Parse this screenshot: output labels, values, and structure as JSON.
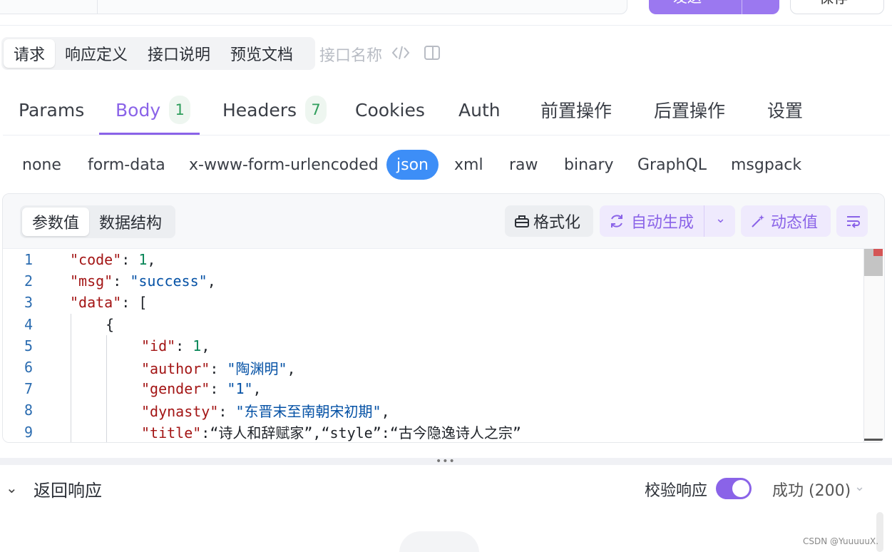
{
  "send": {
    "label": "发送"
  },
  "save": {
    "label": "保存"
  },
  "request_subtabs": [
    {
      "label": "请求",
      "active": true
    },
    {
      "label": "响应定义"
    },
    {
      "label": "接口说明"
    },
    {
      "label": "预览文档"
    }
  ],
  "api_name_placeholder": "接口名称",
  "main_tabs": [
    {
      "label": "Params"
    },
    {
      "label": "Body",
      "badge": "1",
      "active": true
    },
    {
      "label": "Headers",
      "badge": "7"
    },
    {
      "label": "Cookies"
    },
    {
      "label": "Auth"
    },
    {
      "label": "前置操作"
    },
    {
      "label": "后置操作"
    },
    {
      "label": "设置"
    }
  ],
  "body_types": [
    "none",
    "form-data",
    "x-www-form-urlencoded",
    "json",
    "xml",
    "raw",
    "binary",
    "GraphQL",
    "msgpack"
  ],
  "body_type_selected": "json",
  "editor": {
    "view_tabs": [
      {
        "label": "参数值",
        "active": true
      },
      {
        "label": "数据结构"
      }
    ],
    "format_label": "格式化",
    "auto_generate_label": "自动生成",
    "dynamic_value_label": "动态值",
    "line_numbers": [
      "1",
      "2",
      "3",
      "4",
      "5",
      "6",
      "7",
      "8",
      "9"
    ],
    "lines": [
      {
        "indent": 0,
        "tokens": [
          [
            "k",
            "\"code\""
          ],
          [
            "p",
            ": "
          ],
          [
            "n",
            "1"
          ],
          [
            "p",
            ","
          ]
        ]
      },
      {
        "indent": 0,
        "tokens": [
          [
            "k",
            "\"msg\""
          ],
          [
            "p",
            ": "
          ],
          [
            "s",
            "\"success\""
          ],
          [
            "p",
            ","
          ]
        ]
      },
      {
        "indent": 0,
        "tokens": [
          [
            "k",
            "\"data\""
          ],
          [
            "p",
            ": ["
          ]
        ]
      },
      {
        "indent": 1,
        "tokens": [
          [
            "p",
            "{"
          ]
        ]
      },
      {
        "indent": 2,
        "tokens": [
          [
            "k",
            "\"id\""
          ],
          [
            "p",
            ": "
          ],
          [
            "n",
            "1"
          ],
          [
            "p",
            ","
          ]
        ]
      },
      {
        "indent": 2,
        "tokens": [
          [
            "k",
            "\"author\""
          ],
          [
            "p",
            ": "
          ],
          [
            "s",
            "\"陶渊明\""
          ],
          [
            "p",
            ","
          ]
        ]
      },
      {
        "indent": 2,
        "tokens": [
          [
            "k",
            "\"gender\""
          ],
          [
            "p",
            ": "
          ],
          [
            "s",
            "\"1\""
          ],
          [
            "p",
            ","
          ]
        ]
      },
      {
        "indent": 2,
        "tokens": [
          [
            "k",
            "\"dynasty\""
          ],
          [
            "p",
            ": "
          ],
          [
            "s",
            "\"东晋末至南朝宋初期\""
          ],
          [
            "p",
            ","
          ]
        ]
      },
      {
        "indent": 2,
        "tokens": [
          [
            "k",
            "\"title\""
          ],
          [
            "p",
            ":“诗人和辞赋家”,“style”:“古今隐逸诗人之宗”"
          ]
        ]
      }
    ]
  },
  "response": {
    "title": "返回响应",
    "verify_label": "校验响应",
    "verify_enabled": true,
    "status": "成功 (200)"
  },
  "colors": {
    "accent": "#8a63e8",
    "selected_blue": "#3d8ef7",
    "badge_green": "#2f9e5c"
  },
  "watermark": "CSDN @YuuuuuX."
}
